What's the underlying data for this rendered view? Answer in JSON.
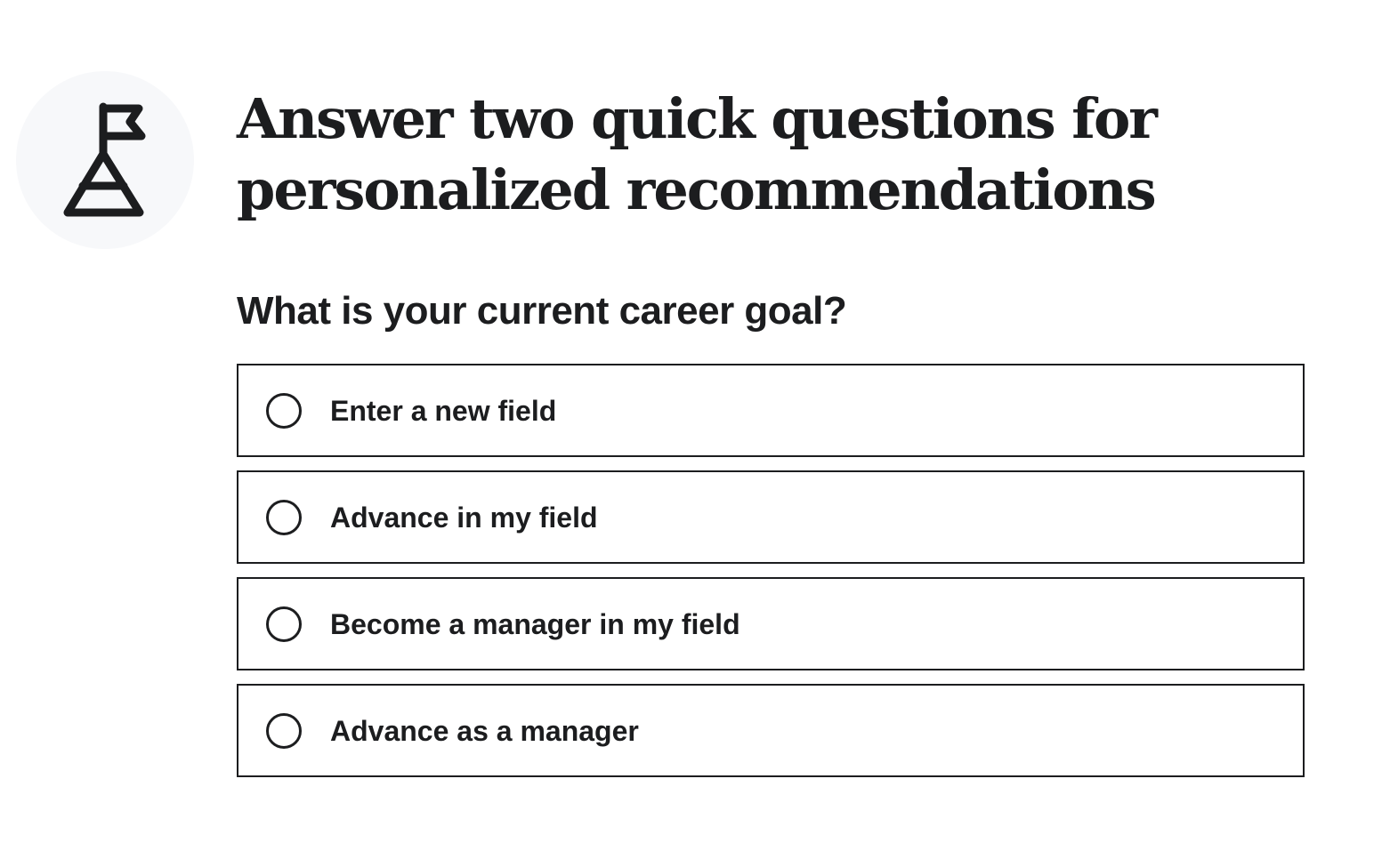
{
  "header": {
    "icon": "flag-on-mountain-icon",
    "title": "Answer two quick questions for personalized recommendations"
  },
  "question": {
    "text": "What is your current career goal?",
    "options": [
      {
        "label": "Enter a new field",
        "selected": false
      },
      {
        "label": "Advance in my field",
        "selected": false
      },
      {
        "label": "Become a manager in my field",
        "selected": false
      },
      {
        "label": "Advance as a manager",
        "selected": false
      }
    ]
  },
  "colors": {
    "text": "#1c1d1f",
    "icon_background": "#f7f8fa",
    "option_border": "#1c1d1f",
    "background": "#ffffff"
  }
}
